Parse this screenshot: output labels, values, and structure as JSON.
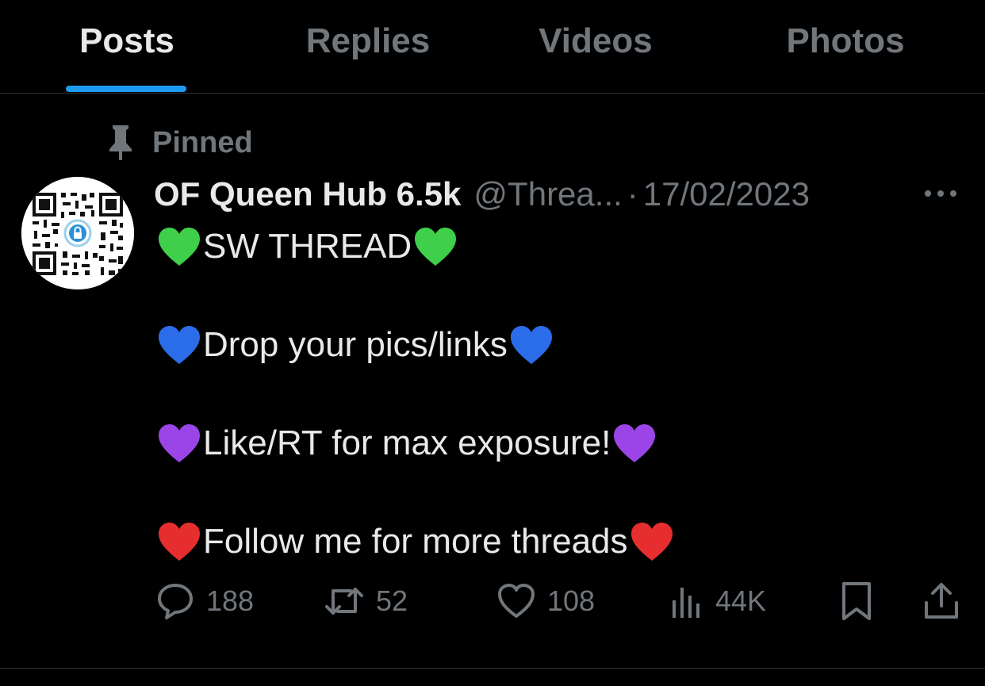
{
  "tabs": [
    {
      "label": "Posts",
      "active": true
    },
    {
      "label": "Replies",
      "active": false
    },
    {
      "label": "Videos",
      "active": false
    },
    {
      "label": "Photos",
      "active": false
    }
  ],
  "pinned_label": "Pinned",
  "post": {
    "author_name": "OF Queen Hub 6.5k",
    "handle": "@Threa...",
    "separator": "·",
    "date": "17/02/2023",
    "lines": [
      {
        "emoji": "green-heart",
        "text": "SW THREAD"
      },
      {
        "emoji": "blue-heart",
        "text": "Drop your pics/links"
      },
      {
        "emoji": "purple-heart",
        "text": "Like/RT for max exposure!"
      },
      {
        "emoji": "red-heart",
        "text": "Follow me for more threads"
      }
    ],
    "stats": {
      "replies": "188",
      "retweets": "52",
      "likes": "108",
      "views": "44K"
    }
  },
  "colors": {
    "background": "#000000",
    "text_primary": "#e7e9ea",
    "text_secondary": "#71767b",
    "accent": "#1d9bf0",
    "divider": "#2f3336",
    "green_heart": "#3fcf4a",
    "blue_heart": "#2b6de8",
    "purple_heart": "#9b45e8",
    "red_heart": "#e62e2e"
  }
}
